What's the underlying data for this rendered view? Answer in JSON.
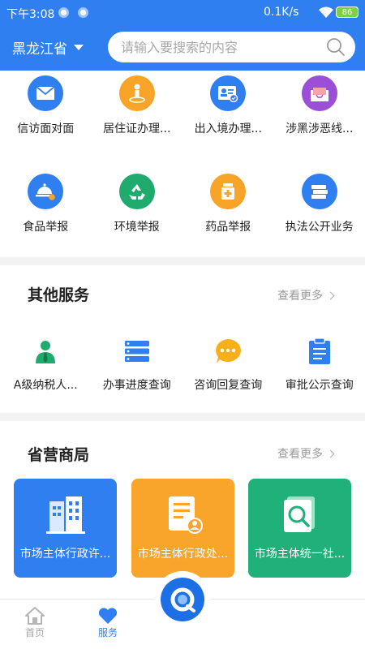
{
  "status_bar": {
    "time": "下午3:08",
    "network_speed": "0.1K/s",
    "battery": "86"
  },
  "header": {
    "province": "黑龙江省",
    "search_placeholder": "请输入要搜索的内容"
  },
  "top_grid": [
    {
      "label": "信访面对面",
      "icon": "envelope-icon",
      "color": "#2f7ff0"
    },
    {
      "label": "居住证办理...",
      "icon": "person-pin-icon",
      "color": "#f7a429"
    },
    {
      "label": "出入境办理...",
      "icon": "id-card-icon",
      "color": "#2f7ff0"
    },
    {
      "label": "涉黑涉恶线...",
      "icon": "mail-tray-icon",
      "color": "#9b4fd6"
    },
    {
      "label": "食品举报",
      "icon": "food-dome-icon",
      "color": "#2f7ff0"
    },
    {
      "label": "环境举报",
      "icon": "recycle-icon",
      "color": "#1fab6e"
    },
    {
      "label": "药品举报",
      "icon": "medicine-icon",
      "color": "#f7a429"
    },
    {
      "label": "执法公开业务",
      "icon": "books-icon",
      "color": "#2f7ff0"
    }
  ],
  "other_services": {
    "title": "其他服务",
    "see_more": "查看更多",
    "items": [
      {
        "label": "A级纳税人...",
        "icon": "taxpayer-icon",
        "color": "#1fab6e"
      },
      {
        "label": "办事进度查询",
        "icon": "list-icon",
        "color": "#2f7ff0"
      },
      {
        "label": "咨询回复查询",
        "icon": "chat-bubble-icon",
        "color": "#f7b01a"
      },
      {
        "label": "审批公示查询",
        "icon": "clipboard-icon",
        "color": "#2f7ff0"
      }
    ]
  },
  "bureaus": {
    "title": "省营商局",
    "see_more": "查看更多",
    "tiles": [
      {
        "label": "市场主体行政许...",
        "icon": "building-icon",
        "color": "#2f7ff0"
      },
      {
        "label": "市场主体行政处...",
        "icon": "document-person-icon",
        "color": "#f9a42b"
      },
      {
        "label": "市场主体统一社...",
        "icon": "magnify-doc-icon",
        "color": "#20b07a"
      }
    ]
  },
  "bottom_nav": {
    "home": "首页",
    "services": "服务"
  }
}
